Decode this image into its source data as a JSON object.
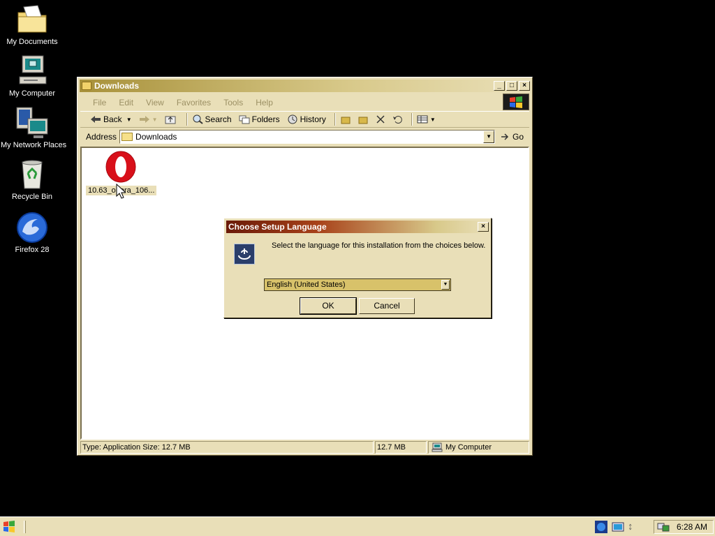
{
  "desktop": {
    "icons": [
      {
        "label": "My Documents",
        "icon": "folder-documents-icon"
      },
      {
        "label": "My Computer",
        "icon": "computer-icon"
      },
      {
        "label": "My Network Places",
        "icon": "network-places-icon"
      },
      {
        "label": "Recycle Bin",
        "icon": "recycle-bin-icon"
      },
      {
        "label": "Firefox 28",
        "icon": "firefox-icon"
      }
    ]
  },
  "explorer": {
    "title": "Downloads",
    "menu": [
      "File",
      "Edit",
      "View",
      "Favorites",
      "Tools",
      "Help"
    ],
    "toolbar": {
      "back": "Back",
      "search": "Search",
      "folders": "Folders",
      "history": "History"
    },
    "address": {
      "label": "Address",
      "value": "Downloads",
      "go": "Go"
    },
    "files": [
      {
        "name": "10.63_opera_106...",
        "icon": "opera-icon"
      }
    ],
    "status": {
      "info": "Type: Application Size: 12.7 MB",
      "size": "12.7 MB",
      "zone": "My Computer"
    }
  },
  "dialog": {
    "title": "Choose Setup Language",
    "message": "Select the language for this installation from the choices below.",
    "selected_language": "English (United States)",
    "ok": "OK",
    "cancel": "Cancel"
  },
  "taskbar": {
    "clock": "6:28 AM"
  },
  "colors": {
    "desktop_bg": "#000000",
    "chrome_bg": "#e9dfb8",
    "dialog_title_start": "#6a1a08",
    "selection": "#d8c26a"
  }
}
